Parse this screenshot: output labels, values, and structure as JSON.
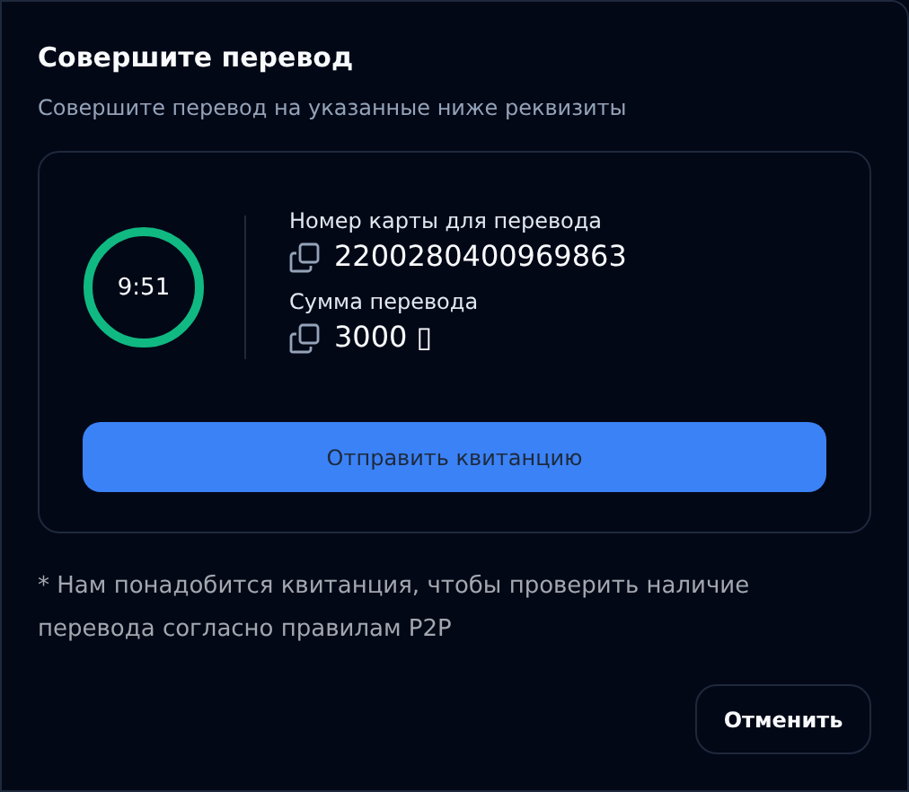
{
  "dialog": {
    "title": "Совершите перевод",
    "subtitle": "Совершите перевод на указанные ниже реквизиты"
  },
  "timer": {
    "text": "9:51",
    "level": 1
  },
  "details": [
    {
      "label": "Номер карты для перевода",
      "value": "2200280400969863"
    },
    {
      "label": "Сумма перевода",
      "value": "3000 ▯"
    }
  ],
  "submit_button": "Отправить квитанцию",
  "note": "* Нам понадобится квитанция, чтобы проверить наличие перевода согласно правилам P2P",
  "cancel_button": "Отменить"
}
